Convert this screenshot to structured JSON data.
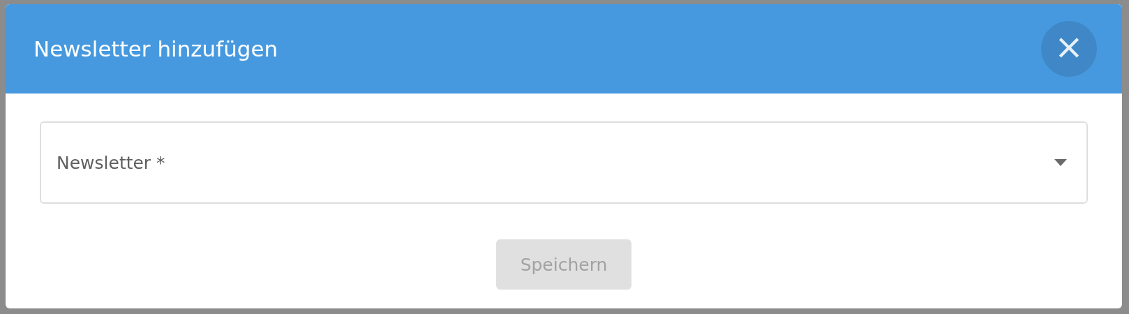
{
  "dialog": {
    "title": "Newsletter hinzufügen",
    "close_label": "×"
  },
  "field": {
    "placeholder": "Newsletter *"
  },
  "save_button": {
    "label": "Speichern",
    "disabled": true
  }
}
